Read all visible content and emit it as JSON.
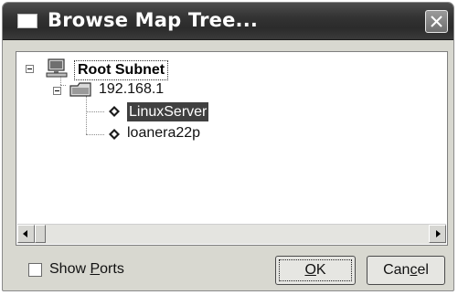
{
  "window": {
    "title": "Browse Map Tree..."
  },
  "tree": {
    "root": {
      "label": "Root Subnet",
      "icon": "network-computer-icon",
      "expanded": true
    },
    "subnet": {
      "label": "192.168.1",
      "icon": "subnet-folder-icon",
      "expanded": true
    },
    "hosts": [
      {
        "label": "LinuxServer",
        "icon": "host-diamond-icon",
        "selected": true
      },
      {
        "label": "loanera22p",
        "icon": "host-diamond-icon",
        "selected": false
      }
    ]
  },
  "options": {
    "show_ports_label_accel": "S",
    "show_ports_label_rest_1": "how ",
    "show_ports_label_accel2": "P",
    "show_ports_label_rest_2": "orts",
    "show_ports_checked": false
  },
  "buttons": {
    "ok_accel": "O",
    "ok_rest": "K",
    "cancel_pre": "Can",
    "cancel_accel": "c",
    "cancel_post": "el"
  },
  "colors": {
    "titlebar": "#333333",
    "dialog_bg": "#d8d8d0",
    "selection_bg": "#404040"
  }
}
